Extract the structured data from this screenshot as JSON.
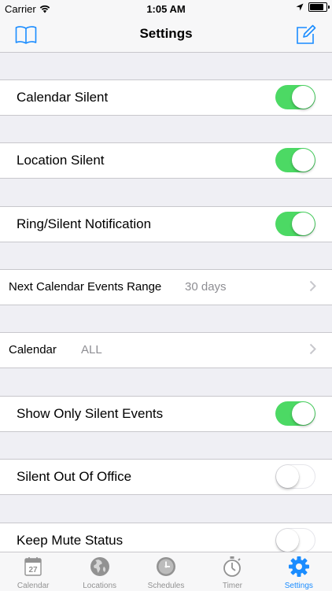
{
  "status_bar": {
    "carrier": "Carrier",
    "time": "1:05 AM",
    "battery_level": 0.95
  },
  "nav": {
    "title": "Settings",
    "left_icon": "book-icon",
    "right_icon": "compose-icon"
  },
  "settings": {
    "calendar_silent": {
      "label": "Calendar Silent",
      "on": true
    },
    "location_silent": {
      "label": "Location Silent",
      "on": true
    },
    "ring_silent_notification": {
      "label": "Ring/Silent Notification",
      "on": true
    },
    "next_calendar_events_range": {
      "label": "Next Calendar Events Range",
      "value": "30 days"
    },
    "calendar": {
      "label": "Calendar",
      "value": "ALL"
    },
    "show_only_silent_events": {
      "label": "Show Only Silent Events",
      "on": true
    },
    "silent_out_of_office": {
      "label": "Silent Out Of Office",
      "on": false
    },
    "keep_mute_status": {
      "label": "Keep Mute Status",
      "on": false
    }
  },
  "tabs": [
    {
      "label": "Calendar",
      "icon": "calendar-icon",
      "badge_text": "27"
    },
    {
      "label": "Locations",
      "icon": "globe-icon"
    },
    {
      "label": "Schedules",
      "icon": "clock-icon"
    },
    {
      "label": "Timer",
      "icon": "stopwatch-icon"
    },
    {
      "label": "Settings",
      "icon": "gear-icon",
      "active": true
    }
  ],
  "colors": {
    "tint": "#1a8cff",
    "toggle_on": "#4cd964",
    "background": "#efeff4",
    "inactive_tab": "#929292"
  }
}
